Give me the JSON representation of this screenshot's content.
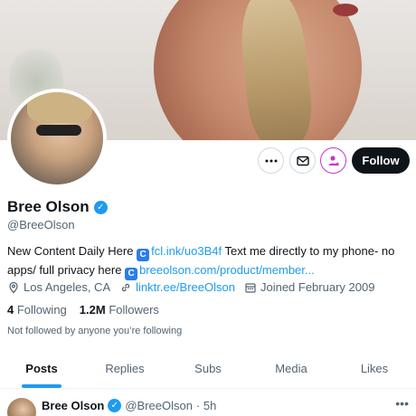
{
  "profile": {
    "name": "Bree Olson",
    "handle": "@BreeOlson",
    "bio_text_1": "New Content Daily Here",
    "bio_link_1": "fcl.ink/uo3B4f",
    "bio_text_2": "Text me directly to my phone- no apps/ full privacy here",
    "bio_link_2": "breeolson.com/product/member...",
    "location": "Los Angeles, CA",
    "website": "linktr.ee/BreeOlson",
    "joined": "Joined February 2009",
    "following_count": "4",
    "following_label": "Following",
    "followers_count": "1.2M",
    "followers_label": "Followers",
    "not_followed_text": "Not followed by anyone you’re following"
  },
  "actions": {
    "follow_label": "Follow"
  },
  "tabs": [
    {
      "label": "Posts",
      "active": true
    },
    {
      "label": "Replies",
      "active": false
    },
    {
      "label": "Subs",
      "active": false
    },
    {
      "label": "Media",
      "active": false
    },
    {
      "label": "Likes",
      "active": false
    }
  ],
  "post": {
    "author": "Bree Olson",
    "handle": "@BreeOlson",
    "time": "· 5h"
  },
  "colors": {
    "accent": "#1d9bf0",
    "text": "#0f1419",
    "muted": "#536471"
  }
}
